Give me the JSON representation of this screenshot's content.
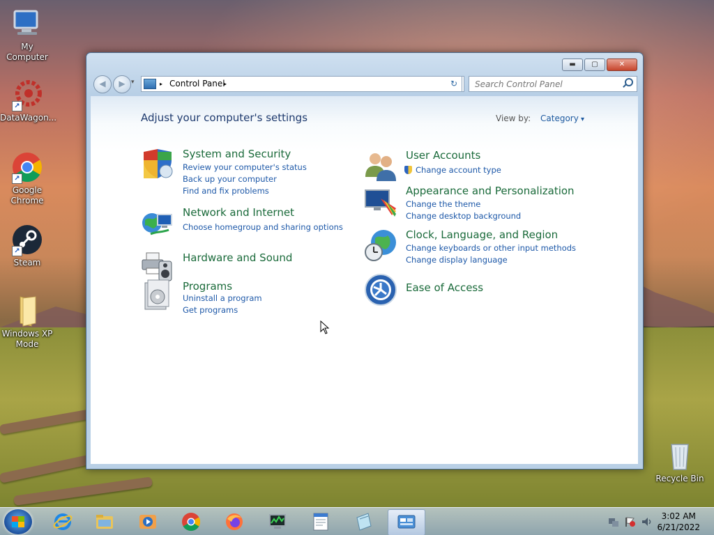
{
  "desktop": {
    "icons": [
      {
        "label": "My Computer"
      },
      {
        "label": "DataWagon..."
      },
      {
        "label": "Google Chrome"
      },
      {
        "label": "Steam"
      },
      {
        "label": "Windows XP Mode"
      },
      {
        "label": "Recycle Bin"
      }
    ]
  },
  "window": {
    "controls": {
      "minimize": "▬",
      "maximize": "▢",
      "close": "✕"
    },
    "address": {
      "crumb": "Control Panel",
      "arrow": "▸",
      "dropdown": "▾"
    },
    "nav": {
      "back": "◀",
      "forward": "▶",
      "history": "▾",
      "refresh": "↻"
    },
    "search": {
      "placeholder": "Search Control Panel"
    },
    "heading": "Adjust your computer's settings",
    "view_by": {
      "label": "View by:",
      "value": "Category"
    },
    "categories": [
      {
        "title": "System and Security",
        "links": [
          "Review your computer's status",
          "Back up your computer",
          "Find and fix problems"
        ]
      },
      {
        "title": "Network and Internet",
        "links": [
          "Choose homegroup and sharing options"
        ]
      },
      {
        "title": "Hardware and Sound",
        "links": []
      },
      {
        "title": "Programs",
        "links": [
          "Uninstall a program",
          "Get programs"
        ]
      },
      {
        "title": "User Accounts",
        "links": [
          "Change account type"
        ]
      },
      {
        "title": "Appearance and Personalization",
        "links": [
          "Change the theme",
          "Change desktop background"
        ]
      },
      {
        "title": "Clock, Language, and Region",
        "links": [
          "Change keyboards or other input methods",
          "Change display language"
        ]
      },
      {
        "title": "Ease of Access",
        "links": []
      }
    ]
  },
  "taskbar": {
    "items": [
      "start",
      "internet-explorer",
      "windows-explorer",
      "media-player",
      "chrome",
      "firefox",
      "task-manager",
      "wordpad",
      "notepad",
      "control-panel"
    ],
    "clock": {
      "time": "3:02 AM",
      "date": "6/21/2022"
    }
  }
}
